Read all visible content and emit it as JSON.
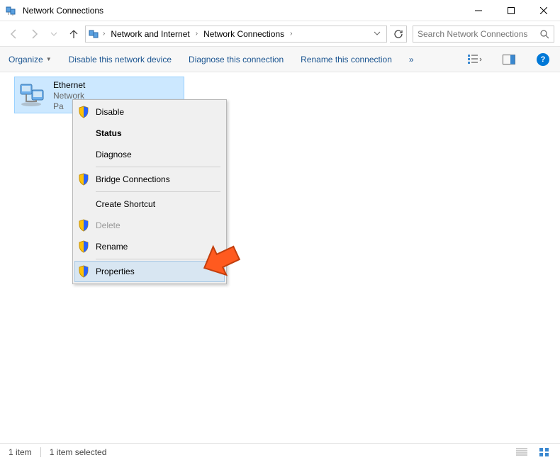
{
  "window": {
    "title": "Network Connections"
  },
  "breadcrumbs": {
    "root": "Network and Internet",
    "current": "Network Connections"
  },
  "search": {
    "placeholder": "Search Network Connections"
  },
  "toolbar": {
    "organize": "Organize",
    "disable": "Disable this network device",
    "diagnose": "Diagnose this connection",
    "rename": "Rename this connection",
    "more": "»"
  },
  "adapter": {
    "name": "Ethernet",
    "network": "Network",
    "description": "Pa"
  },
  "context_menu": {
    "disable": "Disable",
    "status": "Status",
    "diagnose": "Diagnose",
    "bridge": "Bridge Connections",
    "shortcut": "Create Shortcut",
    "delete": "Delete",
    "rename": "Rename",
    "properties": "Properties"
  },
  "statusbar": {
    "count": "1 item",
    "selected": "1 item selected"
  }
}
